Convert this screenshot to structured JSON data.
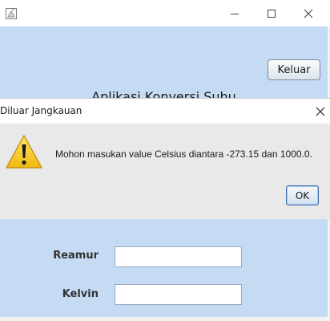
{
  "app_window": {
    "title_icon": "java-app-icon",
    "controls": {
      "minimize_icon": "minimize-icon",
      "maximize_icon": "maximize-icon",
      "close_icon": "close-icon"
    },
    "exit_button_label": "Keluar",
    "heading": "Aplikasi Konversi Suhu",
    "fields": {
      "reamur_label": "Reamur",
      "reamur_value": "",
      "kelvin_label": "Kelvin",
      "kelvin_value": ""
    },
    "background_color": "#c5daf3"
  },
  "dialog": {
    "title": "Diluar Jangkauan",
    "close_icon": "close-icon",
    "icon": "warning-icon",
    "message": "Mohon masukan value Celsius diantara -273.15 dan 1000.0.",
    "ok_label": "OK",
    "warning_color": "#f2c81b"
  }
}
